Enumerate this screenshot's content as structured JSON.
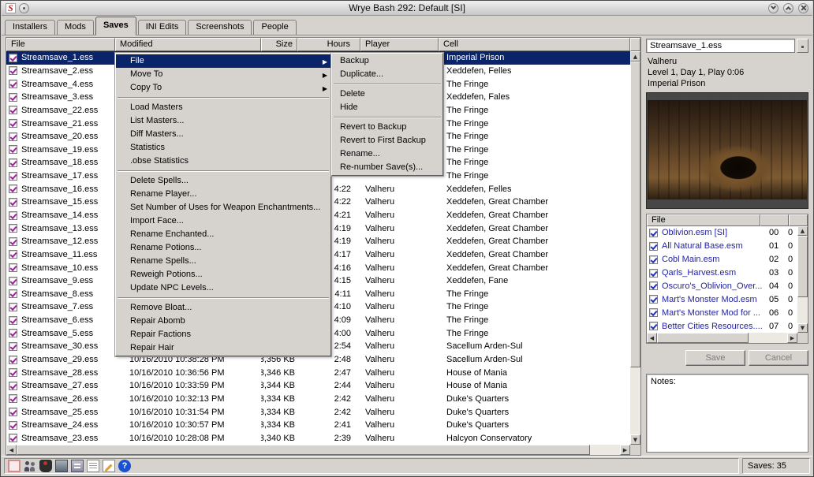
{
  "window": {
    "title": "Wrye Bash 292: Default [SI]"
  },
  "tabs": [
    {
      "label": "Installers",
      "active": false
    },
    {
      "label": "Mods",
      "active": false
    },
    {
      "label": "Saves",
      "active": true
    },
    {
      "label": "INI Edits",
      "active": false
    },
    {
      "label": "Screenshots",
      "active": false
    },
    {
      "label": "People",
      "active": false
    }
  ],
  "saves_table": {
    "columns": [
      "File",
      "Modified",
      "Size",
      "Hours",
      "Player",
      "Cell"
    ],
    "rows": [
      {
        "file": "Streamsave_1.ess",
        "modified": "",
        "size": "",
        "hours": "",
        "player": "",
        "cell": "Imperial Prison",
        "selected": true
      },
      {
        "file": "Streamsave_2.ess",
        "modified": "",
        "size": "",
        "hours": "",
        "player": "",
        "cell": "Xeddefen, Felles"
      },
      {
        "file": "Streamsave_4.ess",
        "modified": "",
        "size": "",
        "hours": "",
        "player": "",
        "cell": "The Fringe"
      },
      {
        "file": "Streamsave_3.ess",
        "modified": "",
        "size": "",
        "hours": "",
        "player": "",
        "cell": "Xeddefen, Fales"
      },
      {
        "file": "Streamsave_22.ess",
        "modified": "",
        "size": "",
        "hours": "",
        "player": "",
        "cell": "The Fringe"
      },
      {
        "file": "Streamsave_21.ess",
        "modified": "",
        "size": "",
        "hours": "",
        "player": "",
        "cell": "The Fringe"
      },
      {
        "file": "Streamsave_20.ess",
        "modified": "",
        "size": "",
        "hours": "",
        "player": "",
        "cell": "The Fringe"
      },
      {
        "file": "Streamsave_19.ess",
        "modified": "",
        "size": "",
        "hours": "",
        "player": "",
        "cell": "The Fringe"
      },
      {
        "file": "Streamsave_18.ess",
        "modified": "",
        "size": "",
        "hours": "",
        "player": "",
        "cell": "The Fringe"
      },
      {
        "file": "Streamsave_17.ess",
        "modified": "",
        "size": "",
        "hours": "",
        "player": "",
        "cell": "The Fringe"
      },
      {
        "file": "Streamsave_16.ess",
        "modified": "",
        "size": "",
        "hours": "4:22",
        "player": "Valheru",
        "cell": "Xeddefen, Felles"
      },
      {
        "file": "Streamsave_15.ess",
        "modified": "",
        "size": "",
        "hours": "4:22",
        "player": "Valheru",
        "cell": "Xeddefen, Great Chamber"
      },
      {
        "file": "Streamsave_14.ess",
        "modified": "",
        "size": "",
        "hours": "4:21",
        "player": "Valheru",
        "cell": "Xeddefen, Great Chamber"
      },
      {
        "file": "Streamsave_13.ess",
        "modified": "",
        "size": "",
        "hours": "4:19",
        "player": "Valheru",
        "cell": "Xeddefen, Great Chamber"
      },
      {
        "file": "Streamsave_12.ess",
        "modified": "",
        "size": "",
        "hours": "4:19",
        "player": "Valheru",
        "cell": "Xeddefen, Great Chamber"
      },
      {
        "file": "Streamsave_11.ess",
        "modified": "",
        "size": "",
        "hours": "4:17",
        "player": "Valheru",
        "cell": "Xeddefen, Great Chamber"
      },
      {
        "file": "Streamsave_10.ess",
        "modified": "",
        "size": "",
        "hours": "4:16",
        "player": "Valheru",
        "cell": "Xeddefen, Great Chamber"
      },
      {
        "file": "Streamsave_9.ess",
        "modified": "",
        "size": "",
        "hours": "4:15",
        "player": "Valheru",
        "cell": "Xeddefen, Fane"
      },
      {
        "file": "Streamsave_8.ess",
        "modified": "",
        "size": "",
        "hours": "4:11",
        "player": "Valheru",
        "cell": "The Fringe"
      },
      {
        "file": "Streamsave_7.ess",
        "modified": "",
        "size": "",
        "hours": "4:10",
        "player": "Valheru",
        "cell": "The Fringe"
      },
      {
        "file": "Streamsave_6.ess",
        "modified": "",
        "size": "",
        "hours": "4:09",
        "player": "Valheru",
        "cell": "The Fringe"
      },
      {
        "file": "Streamsave_5.ess",
        "modified": "",
        "size": "",
        "hours": "4:00",
        "player": "Valheru",
        "cell": "The Fringe"
      },
      {
        "file": "Streamsave_30.ess",
        "modified": "",
        "size": "",
        "hours": "2:54",
        "player": "Valheru",
        "cell": "Sacellum Arden-Sul"
      },
      {
        "file": "Streamsave_29.ess",
        "modified": "10/16/2010 10:38:28 PM",
        "size": "3,356 KB",
        "hours": "2:48",
        "player": "Valheru",
        "cell": "Sacellum Arden-Sul"
      },
      {
        "file": "Streamsave_28.ess",
        "modified": "10/16/2010 10:36:56 PM",
        "size": "3,346 KB",
        "hours": "2:47",
        "player": "Valheru",
        "cell": "House of Mania"
      },
      {
        "file": "Streamsave_27.ess",
        "modified": "10/16/2010 10:33:59 PM",
        "size": "3,344 KB",
        "hours": "2:44",
        "player": "Valheru",
        "cell": "House of Mania"
      },
      {
        "file": "Streamsave_26.ess",
        "modified": "10/16/2010 10:32:13 PM",
        "size": "3,334 KB",
        "hours": "2:42",
        "player": "Valheru",
        "cell": "Duke's Quarters"
      },
      {
        "file": "Streamsave_25.ess",
        "modified": "10/16/2010 10:31:54 PM",
        "size": "3,334 KB",
        "hours": "2:42",
        "player": "Valheru",
        "cell": "Duke's Quarters"
      },
      {
        "file": "Streamsave_24.ess",
        "modified": "10/16/2010 10:30:57 PM",
        "size": "3,334 KB",
        "hours": "2:41",
        "player": "Valheru",
        "cell": "Duke's Quarters"
      },
      {
        "file": "Streamsave_23.ess",
        "modified": "10/16/2010 10:28:08 PM",
        "size": "3,340 KB",
        "hours": "2:39",
        "player": "Valheru",
        "cell": "Halcyon Conservatory"
      }
    ]
  },
  "context_menu": {
    "items": [
      {
        "label": "File",
        "submenu": true,
        "highlighted": true
      },
      {
        "label": "Move To",
        "submenu": true
      },
      {
        "label": "Copy To",
        "submenu": true
      },
      {
        "separator": true
      },
      {
        "label": "Load Masters"
      },
      {
        "label": "List Masters..."
      },
      {
        "label": "Diff Masters..."
      },
      {
        "label": "Statistics"
      },
      {
        "label": ".obse Statistics"
      },
      {
        "separator": true
      },
      {
        "label": "Delete Spells..."
      },
      {
        "label": "Rename Player..."
      },
      {
        "label": "Set Number of Uses for Weapon Enchantments..."
      },
      {
        "label": "Import Face..."
      },
      {
        "label": "Rename Enchanted..."
      },
      {
        "label": "Rename Potions..."
      },
      {
        "label": "Rename Spells..."
      },
      {
        "label": "Reweigh Potions..."
      },
      {
        "label": "Update NPC Levels..."
      },
      {
        "separator": true
      },
      {
        "label": "Remove Bloat..."
      },
      {
        "label": "Repair Abomb"
      },
      {
        "label": "Repair Factions"
      },
      {
        "label": "Repair Hair"
      }
    ]
  },
  "file_submenu": {
    "items": [
      {
        "label": "Backup"
      },
      {
        "label": "Duplicate..."
      },
      {
        "separator": true
      },
      {
        "label": "Delete"
      },
      {
        "label": "Hide"
      },
      {
        "separator": true
      },
      {
        "label": "Revert to Backup"
      },
      {
        "label": "Revert to First Backup"
      },
      {
        "label": "Rename..."
      },
      {
        "label": "Re-number Save(s)..."
      }
    ]
  },
  "details": {
    "filename": "Streamsave_1.ess",
    "player_line": "Valheru",
    "level_line": "Level 1, Day 1, Play 0:06",
    "cell_line": "Imperial Prison",
    "masters_header": "File",
    "masters": [
      {
        "name": "Oblivion.esm [SI]",
        "mi": "00",
        "cur": "0"
      },
      {
        "name": "All Natural Base.esm",
        "mi": "01",
        "cur": "0"
      },
      {
        "name": "Cobl Main.esm",
        "mi": "02",
        "cur": "0"
      },
      {
        "name": "Qarls_Harvest.esm",
        "mi": "03",
        "cur": "0"
      },
      {
        "name": "Oscuro's_Oblivion_Over...",
        "mi": "04",
        "cur": "0"
      },
      {
        "name": "Mart's Monster Mod.esm",
        "mi": "05",
        "cur": "0"
      },
      {
        "name": "Mart's Monster Mod for ...",
        "mi": "06",
        "cur": "0"
      },
      {
        "name": "Better Cities Resources....",
        "mi": "07",
        "cur": "0"
      }
    ],
    "save_label": "Save",
    "cancel_label": "Cancel",
    "notes_label": "Notes:"
  },
  "statusbar": {
    "icons": [
      {
        "name": "launcher"
      },
      {
        "name": "people"
      },
      {
        "name": "controller"
      },
      {
        "name": "screen"
      },
      {
        "name": "tools"
      },
      {
        "name": "doc"
      },
      {
        "name": "edit"
      },
      {
        "name": "help"
      }
    ],
    "saves_count": "Saves: 35"
  },
  "colors": {
    "selection": "#0a246a",
    "save_check": "#a020a0",
    "master_check": "#2030c0",
    "help_blue": "#1a50d2"
  }
}
